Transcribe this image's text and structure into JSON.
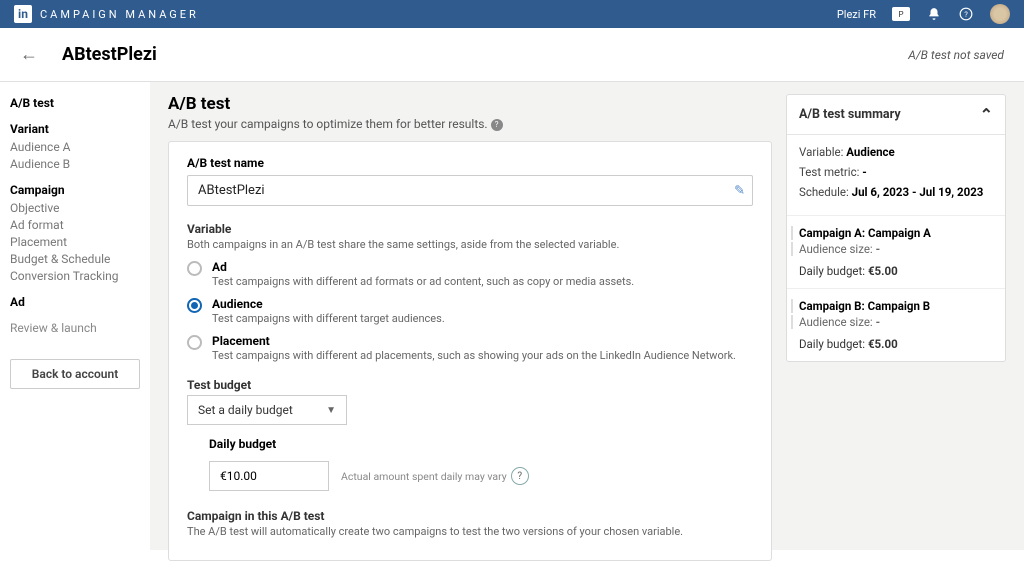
{
  "topbar": {
    "logo_text": "in",
    "app_title": "CAMPAIGN MANAGER",
    "account_name": "Plezi FR",
    "badge": "P"
  },
  "subheader": {
    "title": "ABtestPlezi",
    "status": "A/B test not saved"
  },
  "sidebar": {
    "ab_test": "A/B test",
    "variant_head": "Variant",
    "variant_a": "Audience A",
    "variant_b": "Audience B",
    "campaign_head": "Campaign",
    "objective": "Objective",
    "ad_format": "Ad format",
    "placement": "Placement",
    "budget_schedule": "Budget & Schedule",
    "conversion_tracking": "Conversion Tracking",
    "ad_head": "Ad",
    "review_head": "Review & launch",
    "back_btn": "Back to account"
  },
  "main": {
    "title": "A/B test",
    "subtitle": "A/B test your campaigns to optimize them for better results.",
    "name_label": "A/B test name",
    "name_value": "ABtestPlezi",
    "variable_head": "Variable",
    "variable_desc": "Both campaigns in an A/B test share the same settings, aside from the selected variable.",
    "radios": {
      "ad": {
        "label": "Ad",
        "desc": "Test campaigns with different ad formats or ad content, such as copy or media assets."
      },
      "audience": {
        "label": "Audience",
        "desc": "Test campaigns with different target audiences."
      },
      "placement": {
        "label": "Placement",
        "desc": "Test campaigns with different ad placements, such as showing your ads on the LinkedIn Audience Network."
      }
    },
    "budget_head": "Test budget",
    "budget_select": "Set a daily budget",
    "daily_label": "Daily budget",
    "daily_value": "€10.00",
    "daily_hint": "Actual amount spent daily may vary",
    "campaign_head": "Campaign in this A/B test",
    "campaign_desc": "The A/B test will automatically create two campaigns to test the two versions of your chosen variable."
  },
  "summary": {
    "title": "A/B test summary",
    "variable_label": "Variable:",
    "variable_value": "Audience",
    "metric_label": "Test metric:",
    "metric_value": "-",
    "schedule_label": "Schedule:",
    "schedule_value": "Jul 6, 2023 - Jul 19, 2023",
    "camp_a": {
      "name": "Campaign A: Campaign A",
      "audience_label": "Audience size:",
      "audience_value": "-",
      "budget_label": "Daily budget:",
      "budget_value": "€5.00"
    },
    "camp_b": {
      "name": "Campaign B: Campaign B",
      "audience_label": "Audience size:",
      "audience_value": "-",
      "budget_label": "Daily budget:",
      "budget_value": "€5.00"
    }
  }
}
